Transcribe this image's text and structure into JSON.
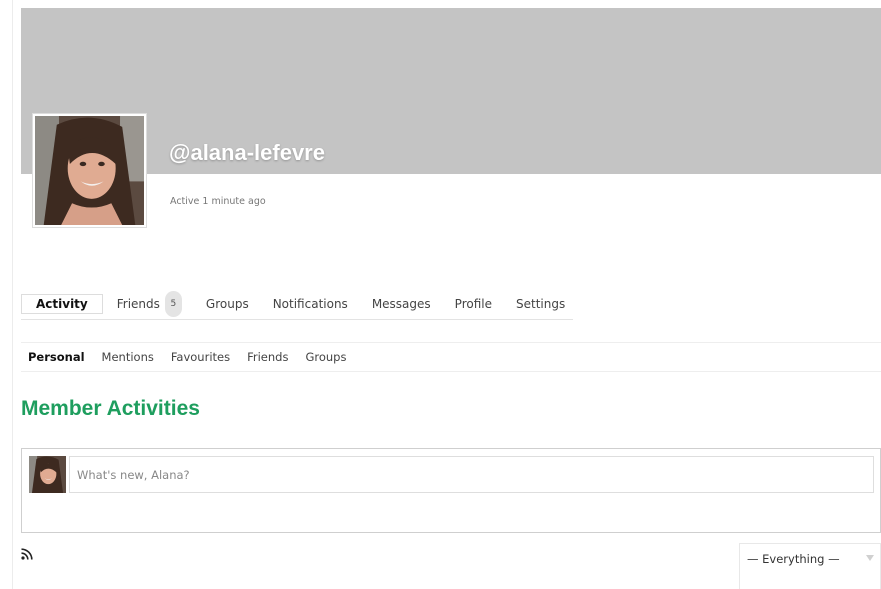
{
  "profile": {
    "handle": "@alana-lefevre",
    "last_active": "Active 1 minute ago",
    "cover_color": "#c4c4c4"
  },
  "main_nav": [
    {
      "label": "Activity",
      "active": true
    },
    {
      "label": "Friends",
      "count": "5"
    },
    {
      "label": "Groups"
    },
    {
      "label": "Notifications"
    },
    {
      "label": "Messages"
    },
    {
      "label": "Profile"
    },
    {
      "label": "Settings"
    }
  ],
  "sub_nav": [
    {
      "label": "Personal",
      "active": true
    },
    {
      "label": "Mentions"
    },
    {
      "label": "Favourites"
    },
    {
      "label": "Friends"
    },
    {
      "label": "Groups"
    }
  ],
  "section": {
    "title": "Member Activities",
    "title_color": "#1e9e5e"
  },
  "post_form": {
    "value": "",
    "placeholder": "What's new, Alana?"
  },
  "feed": {
    "rss_icon": "rss-icon",
    "filter_selected": "— Everything —"
  }
}
